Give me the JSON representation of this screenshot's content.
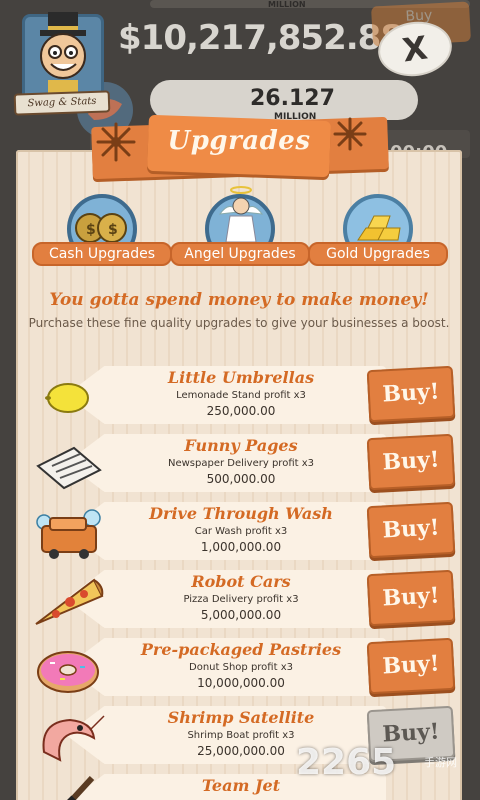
{
  "hud": {
    "money": "$10,217,852.88",
    "top_counter_unit": "MILLION",
    "mid_counter": "26.127",
    "mid_counter_unit": "MILLION",
    "bg_buy_label": "Buy",
    "bg_timer": "00:00",
    "avatar_label": "Swag & Stats",
    "close_label": "X"
  },
  "panel": {
    "title": "Upgrades",
    "tagline": "You gotta spend money to make money!",
    "subline": "Purchase these fine quality upgrades to give your businesses a boost."
  },
  "tabs": [
    {
      "label": "Cash Upgrades",
      "icon": "money-bags-icon"
    },
    {
      "label": "Angel Upgrades",
      "icon": "angel-icon"
    },
    {
      "label": "Gold Upgrades",
      "icon": "gold-bars-icon"
    }
  ],
  "upgrades": [
    {
      "name": "Little Umbrellas",
      "desc": "Lemonade Stand profit x3",
      "price": "250,000.00",
      "buy": "Buy!",
      "enabled": true,
      "icon": "lemon-icon"
    },
    {
      "name": "Funny Pages",
      "desc": "Newspaper Delivery profit x3",
      "price": "500,000.00",
      "buy": "Buy!",
      "enabled": true,
      "icon": "newspaper-icon"
    },
    {
      "name": "Drive Through Wash",
      "desc": "Car Wash profit x3",
      "price": "1,000,000.00",
      "buy": "Buy!",
      "enabled": true,
      "icon": "car-wash-icon"
    },
    {
      "name": "Robot Cars",
      "desc": "Pizza Delivery profit x3",
      "price": "5,000,000.00",
      "buy": "Buy!",
      "enabled": true,
      "icon": "pizza-icon"
    },
    {
      "name": "Pre-packaged Pastries",
      "desc": "Donut Shop profit x3",
      "price": "10,000,000.00",
      "buy": "Buy!",
      "enabled": true,
      "icon": "donut-icon"
    },
    {
      "name": "Shrimp Satellite",
      "desc": "Shrimp Boat profit x3",
      "price": "25,000,000.00",
      "buy": "Buy!",
      "enabled": false,
      "icon": "shrimp-icon"
    },
    {
      "name": "Team Jet",
      "desc": "",
      "price": "",
      "buy": "",
      "enabled": true,
      "icon": "hockey-stick-icon"
    }
  ],
  "watermark": {
    "text": "2265",
    "sub": "手游网"
  },
  "colors": {
    "accent": "#e27f40",
    "title_text": "#d46a24",
    "panel": "#f1e3d2",
    "disabled": "#cfcac3"
  }
}
